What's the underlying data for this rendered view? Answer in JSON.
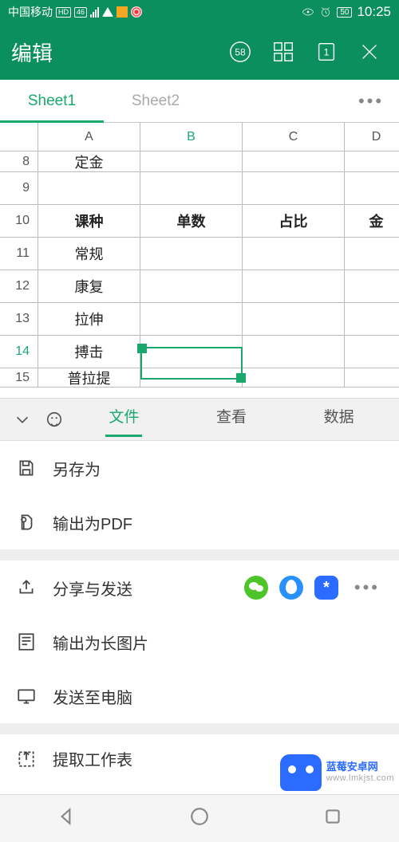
{
  "status": {
    "carrier": "中国移动",
    "hd_badge": "HD",
    "net_badge": "46",
    "battery": "50",
    "time": "10:25"
  },
  "toolbar": {
    "title": "编辑",
    "counter": "58"
  },
  "sheet_tabs": {
    "tabs": [
      "Sheet1",
      "Sheet2"
    ],
    "active_index": 0
  },
  "columns": [
    "A",
    "B",
    "C",
    "D"
  ],
  "active_column_index": 1,
  "rows": [
    {
      "num": "8",
      "a": "定金"
    },
    {
      "num": "9",
      "a": ""
    },
    {
      "num": "10",
      "a": "课种",
      "b": "单数",
      "c": "占比",
      "d": "金",
      "bold": true
    },
    {
      "num": "11",
      "a": "常规"
    },
    {
      "num": "12",
      "a": "康复"
    },
    {
      "num": "13",
      "a": "拉伸"
    },
    {
      "num": "14",
      "a": "搏击"
    },
    {
      "num": "15",
      "a": "普拉提"
    }
  ],
  "active_row_num": "14",
  "menu_tabs": {
    "tabs": [
      "文件",
      "查看",
      "数据"
    ],
    "active_index": 0
  },
  "menu": {
    "save_as": "另存为",
    "export_pdf": "输出为PDF",
    "share": "分享与发送",
    "export_img": "输出为长图片",
    "send_pc": "发送至电脑",
    "extract": "提取工作表"
  },
  "share_more": "•••",
  "share_star": "*",
  "watermark": {
    "line1": "蓝莓安卓网",
    "line2": "www.lmkjst.com"
  }
}
